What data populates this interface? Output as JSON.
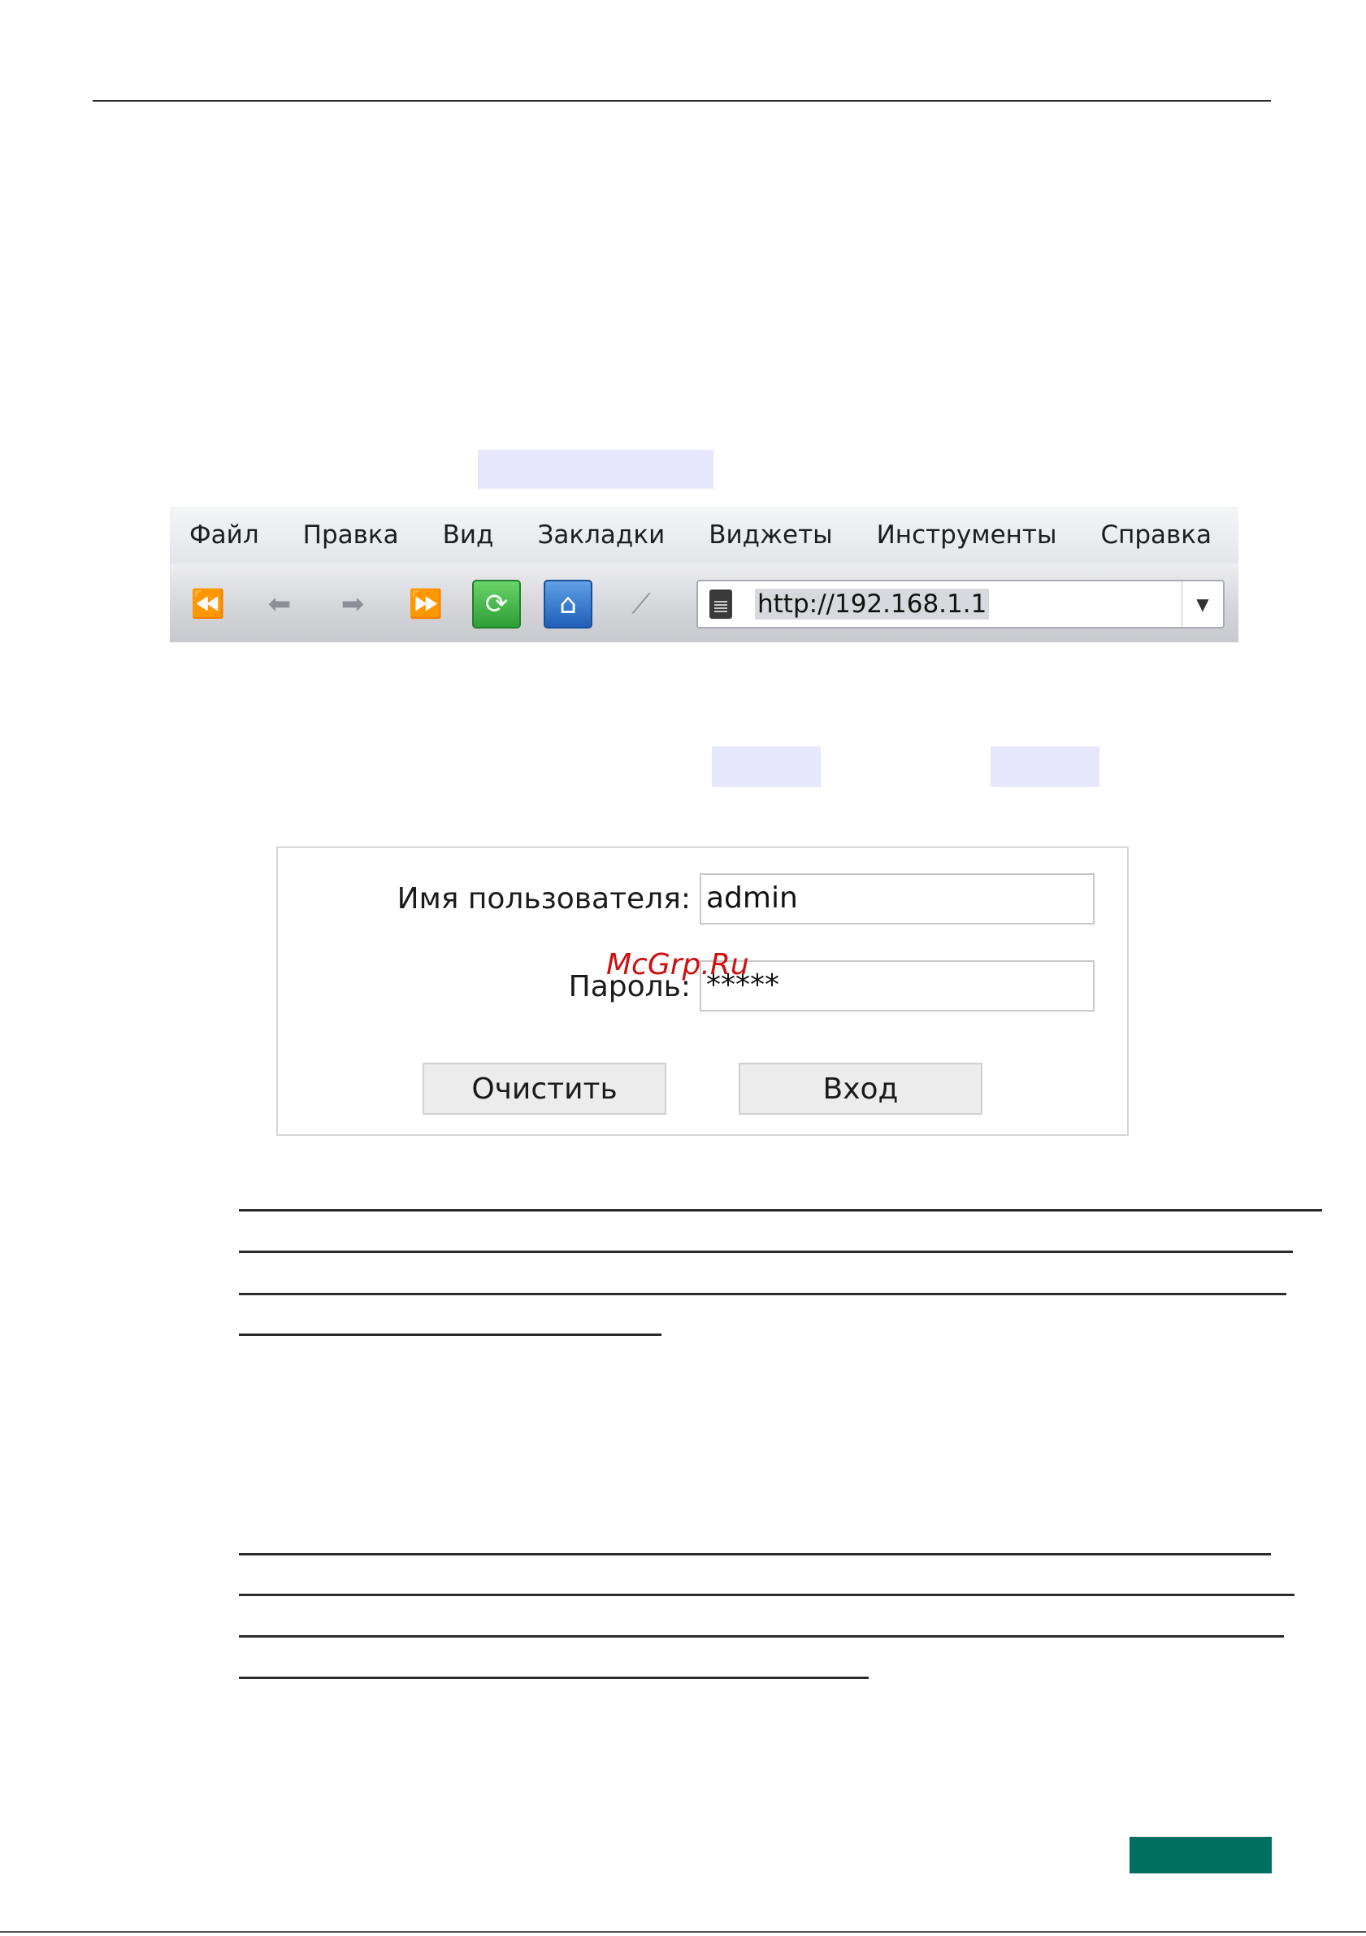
{
  "browser": {
    "menu": [
      "Файл",
      "Правка",
      "Вид",
      "Закладки",
      "Виджеты",
      "Инструменты",
      "Справка"
    ],
    "url": "http://192.168.1.1",
    "icons": [
      "first-icon",
      "back-icon",
      "forward-icon",
      "last-icon",
      "reload-icon",
      "home-icon",
      "edit-icon",
      "page-icon",
      "dropdown-arrow-icon"
    ]
  },
  "login": {
    "username_label": "Имя пользователя:",
    "username_value": "admin",
    "password_label": "Пароль:",
    "password_value": "*****",
    "clear_button": "Очистить",
    "login_button": "Вход"
  },
  "watermark": "McGrp.Ru",
  "colors": {
    "highlight": "#e6e6fc",
    "footer_tab": "#006e61",
    "watermark": "#cf1010",
    "reload_button": "#2e9e35",
    "home_button": "#1f5fb8"
  }
}
